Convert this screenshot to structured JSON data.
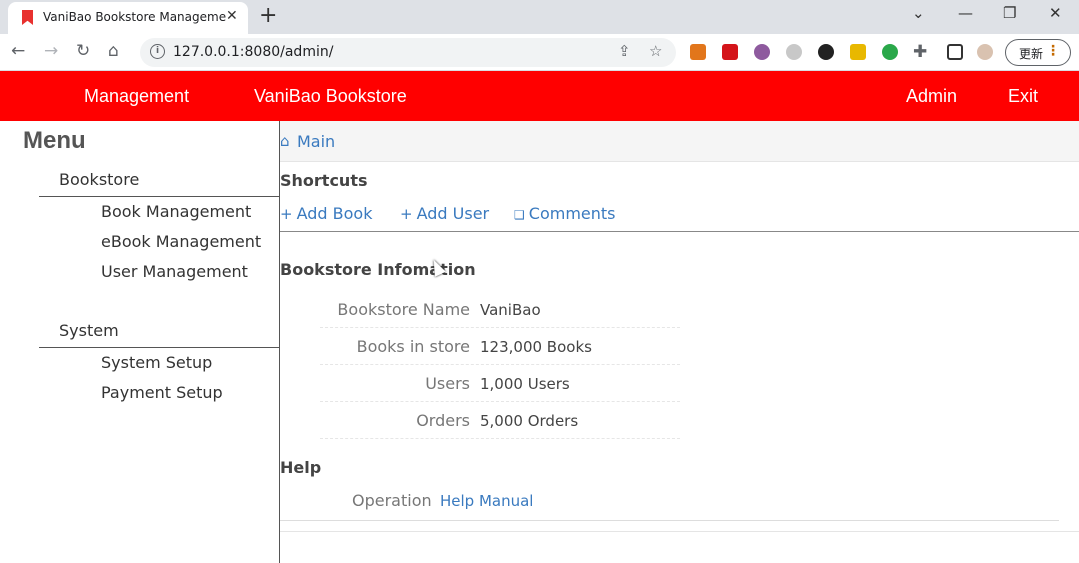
{
  "browser": {
    "tab_title": "VaniBao Bookstore Management",
    "tab_close": "✕",
    "new_tab": "+",
    "url": "127.0.0.1:8080/admin/",
    "update_label": "更新",
    "window_controls": [
      "⌄",
      "—",
      "❐",
      "✕"
    ]
  },
  "appbar": {
    "management": "Management",
    "brand": "VaniBao Bookstore",
    "admin": "Admin",
    "exit": "Exit",
    "color": "#ff0000"
  },
  "sidebar": {
    "title": "Menu",
    "sections": [
      {
        "label": "Bookstore",
        "items": [
          "Book Management",
          "eBook Management",
          "User Management"
        ]
      },
      {
        "label": "System",
        "items": [
          "System Setup",
          "Payment Setup"
        ]
      }
    ]
  },
  "main": {
    "breadcrumb": "Main",
    "shortcuts_title": "Shortcuts",
    "shortcuts": [
      {
        "icon": "plus-icon",
        "label": "Add Book"
      },
      {
        "icon": "plus-icon",
        "label": "Add User"
      },
      {
        "icon": "comment-icon",
        "label": "Comments"
      }
    ],
    "info_title": "Bookstore Infomation",
    "info": [
      {
        "label": "Bookstore Name",
        "value": "VaniBao"
      },
      {
        "label": "Books in store",
        "value": "123,000 Books"
      },
      {
        "label": "Users",
        "value": "1,000 Users"
      },
      {
        "label": "Orders",
        "value": "5,000 Orders"
      }
    ],
    "help_title": "Help",
    "help_label": "Operation",
    "help_link": "Help Manual"
  }
}
